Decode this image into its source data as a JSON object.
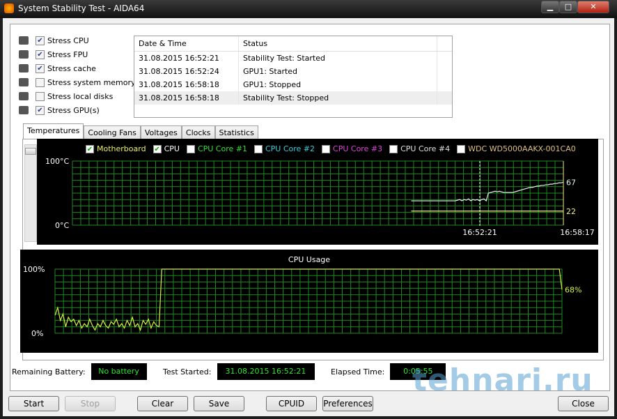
{
  "window": {
    "title": "System Stability Test - AIDA64",
    "min": "▁",
    "max": "□",
    "close": "✕"
  },
  "options": [
    {
      "label": "Stress CPU",
      "checked": true
    },
    {
      "label": "Stress FPU",
      "checked": true
    },
    {
      "label": "Stress cache",
      "checked": true
    },
    {
      "label": "Stress system memory",
      "checked": false
    },
    {
      "label": "Stress local disks",
      "checked": false
    },
    {
      "label": "Stress GPU(s)",
      "checked": true
    }
  ],
  "log": {
    "headers": [
      "Date & Time",
      "Status"
    ],
    "rows": [
      [
        "31.08.2015 16:52:21",
        "Stability Test: Started"
      ],
      [
        "31.08.2015 16:52:24",
        "GPU1: Started"
      ],
      [
        "31.08.2015 16:58:18",
        "GPU1: Stopped"
      ],
      [
        "31.08.2015 16:58:18",
        "Stability Test: Stopped"
      ]
    ]
  },
  "tabs": [
    "Temperatures",
    "Cooling Fans",
    "Voltages",
    "Clocks",
    "Statistics"
  ],
  "chart_data": [
    {
      "type": "line",
      "title": "Temperatures",
      "ylim": [
        0,
        100
      ],
      "ytick_labels": [
        "100°C",
        "0°C"
      ],
      "xtick_labels": [
        "16:52:21",
        "16:58:17"
      ],
      "legend": [
        {
          "name": "Motherboard",
          "checked": true,
          "color": "#f0f060"
        },
        {
          "name": "CPU",
          "checked": true,
          "color": "#ffffff"
        },
        {
          "name": "CPU Core #1",
          "checked": false,
          "color": "#30e030"
        },
        {
          "name": "CPU Core #2",
          "checked": false,
          "color": "#30d0e0"
        },
        {
          "name": "CPU Core #3",
          "checked": false,
          "color": "#e040e0"
        },
        {
          "name": "CPU Core #4",
          "checked": false,
          "color": "#e0e0e0"
        },
        {
          "name": "WDC WD5000AAKX-001CA0",
          "checked": false,
          "color": "#e0c080"
        }
      ],
      "series": [
        {
          "name": "CPU",
          "color": "#e8f0f0",
          "start": 0.69,
          "values": [
            38,
            38,
            38,
            38,
            38,
            38,
            38,
            38,
            38,
            38,
            38,
            38,
            38,
            38,
            38,
            38,
            38,
            38,
            38,
            38,
            38,
            39,
            40,
            38,
            40,
            39,
            41,
            38,
            40,
            39,
            40,
            38,
            40,
            41,
            38,
            50,
            51,
            52,
            53,
            52,
            53,
            52,
            51,
            51,
            51,
            51,
            51,
            52,
            53,
            54,
            55,
            56,
            57,
            58,
            59,
            59,
            60,
            61,
            61,
            62,
            62,
            63,
            63,
            64,
            64,
            65,
            65,
            66,
            66,
            67
          ],
          "last_label": "67"
        },
        {
          "name": "Motherboard",
          "color": "#f0f080",
          "start": 0.69,
          "values": [
            22,
            22
          ],
          "last_label": "22"
        }
      ]
    },
    {
      "type": "line",
      "title": "CPU Usage",
      "ylim": [
        0,
        100
      ],
      "ytick_labels": [
        "100%",
        "0%"
      ],
      "series": [
        {
          "name": "CPU Usage",
          "color": "#d8f040",
          "values": [
            28,
            40,
            20,
            30,
            10,
            25,
            18,
            22,
            12,
            20,
            8,
            15,
            10,
            22,
            12,
            5,
            15,
            10,
            20,
            12,
            8,
            18,
            14,
            22,
            10,
            15,
            8,
            20,
            12,
            25,
            10,
            15,
            5,
            20,
            14,
            22,
            8,
            18,
            12,
            10,
            100,
            100,
            100,
            100,
            100,
            100,
            100,
            100,
            100,
            100,
            100,
            100,
            100,
            100,
            100,
            100,
            100,
            100,
            100,
            100,
            100,
            100,
            100,
            100,
            100,
            100,
            100,
            100,
            100,
            100,
            100,
            100,
            100,
            100,
            100,
            100,
            100,
            100,
            100,
            100,
            100,
            100,
            100,
            100,
            100,
            100,
            100,
            100,
            100,
            100,
            100,
            100,
            100,
            100,
            100,
            100,
            100,
            100,
            100,
            100,
            100,
            100,
            100,
            100,
            100,
            100,
            100,
            100,
            100,
            100,
            100,
            100,
            100,
            100,
            100,
            100,
            100,
            100,
            100,
            100,
            100,
            100,
            100,
            100,
            100,
            100,
            100,
            100,
            100,
            100,
            100,
            100,
            100,
            100,
            100,
            100,
            100,
            100,
            100,
            100,
            100,
            100,
            100,
            100,
            100,
            100,
            100,
            100,
            100,
            100,
            100,
            100,
            100,
            100,
            100,
            100,
            100,
            100,
            100,
            100,
            100,
            100,
            100,
            100,
            100,
            100,
            100,
            100,
            100,
            100,
            100,
            100,
            100,
            100,
            100,
            100,
            100,
            100,
            100,
            100,
            100,
            100,
            100,
            100,
            100,
            100,
            100,
            100,
            100,
            100,
            68
          ],
          "last_label": "68%"
        }
      ]
    }
  ],
  "status": {
    "battery_label": "Remaining Battery:",
    "battery": "No battery",
    "started_label": "Test Started:",
    "started": "31.08.2015 16:52:21",
    "elapsed_label": "Elapsed Time:",
    "elapsed": "0:05:55"
  },
  "buttons": {
    "start": "Start",
    "stop": "Stop",
    "clear": "Clear",
    "save": "Save",
    "cpuid": "CPUID",
    "preferences": "Preferences",
    "close": "Close"
  },
  "watermark": "tehnari.ru"
}
